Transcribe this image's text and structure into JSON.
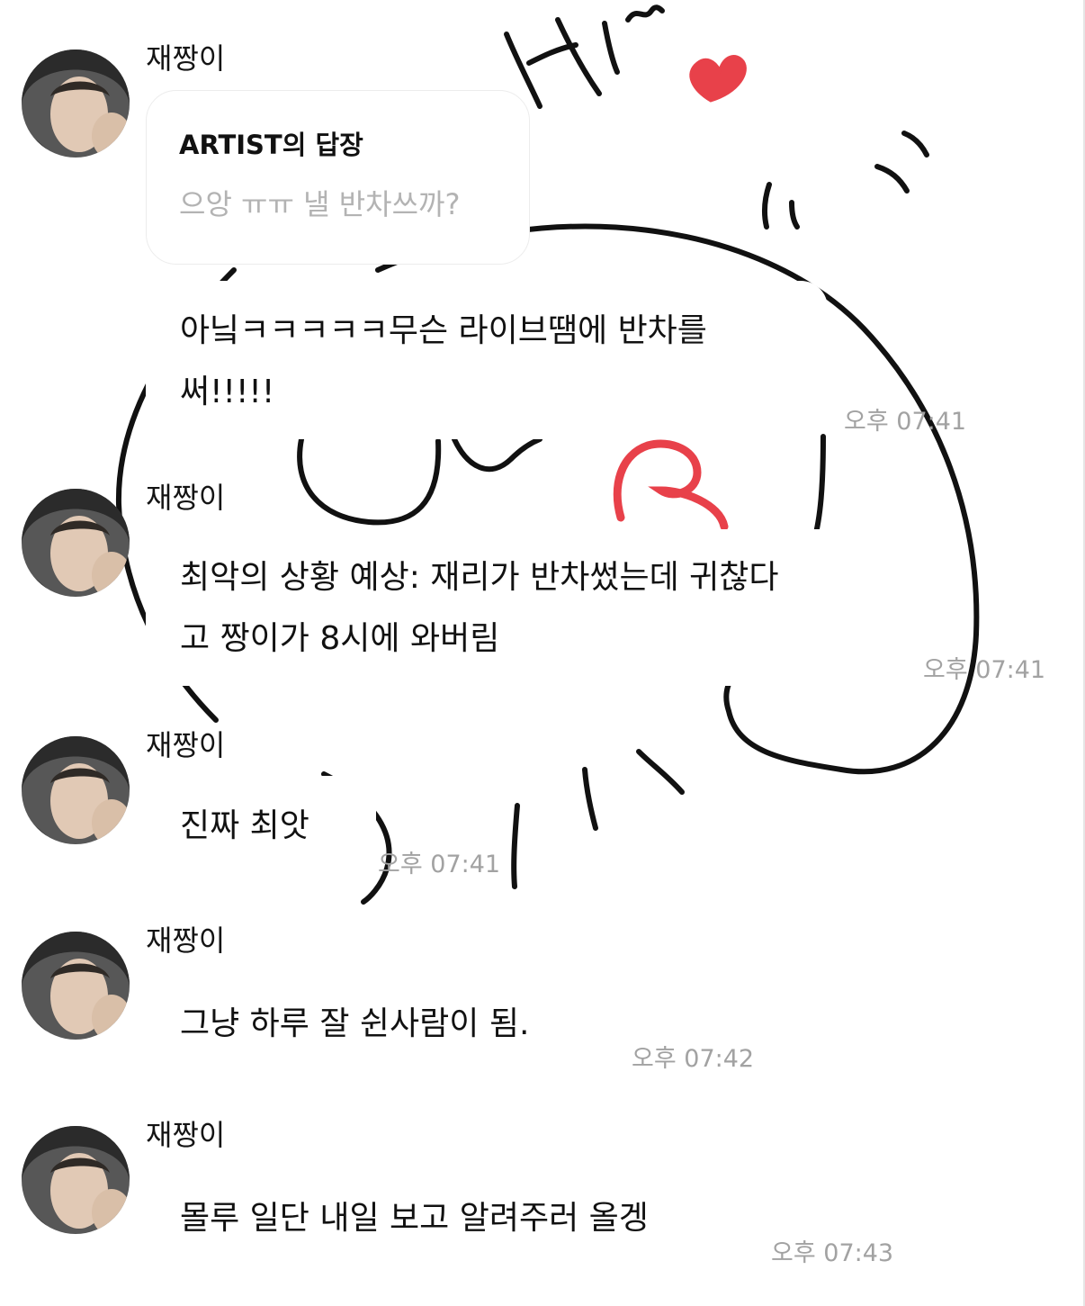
{
  "colors": {
    "background": "#ffffff",
    "bubble": "#ffffff",
    "text": "#111111",
    "quote_text": "#b3b3b3",
    "timestamp": "#a2a2a2",
    "doodle_line": "#111111",
    "heart": "#e8414a"
  },
  "doodle": {
    "greeting": "HI~"
  },
  "messages": [
    {
      "sender": "재짱이",
      "quote": {
        "title": "ARTIST의 답장",
        "text": "으앙 ㅠㅠ 낼 반차쓰까?"
      },
      "lines": [
        "아닠ㅋㅋㅋㅋㅋ무슨 라이브땜에 반차를",
        "써!!!!!"
      ],
      "time": "오후 07:41"
    },
    {
      "sender": "재짱이",
      "lines": [
        "최악의 상황 예상: 재리가 반차썼는데 귀찮다",
        "고 짱이가 8시에 와버림"
      ],
      "time": "오후 07:41"
    },
    {
      "sender": "재짱이",
      "lines": [
        "진짜 최앗"
      ],
      "time": "오후 07:41"
    },
    {
      "sender": "재짱이",
      "lines": [
        "그냥 하루 잘 쉰사람이 됨."
      ],
      "time": "오후 07:42"
    },
    {
      "sender": "재짱이",
      "lines": [
        "몰루 일단 내일 보고 알려주러 올겡"
      ],
      "time": "오후 07:43"
    }
  ]
}
